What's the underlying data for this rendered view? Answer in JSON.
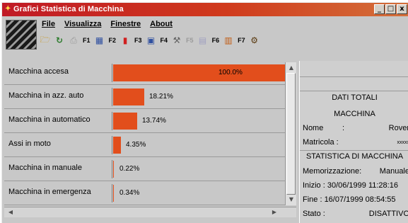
{
  "window": {
    "title": "Grafici Statistica di Macchina",
    "buttons": [
      "_",
      "□",
      "x"
    ]
  },
  "menu": {
    "items": [
      {
        "label": "File"
      },
      {
        "label": "Visualizza"
      },
      {
        "label": "Finestre"
      },
      {
        "label": "About"
      }
    ]
  },
  "toolbar": {
    "groups": [
      {
        "icons": [
          "folder-icon",
          "refresh-icon"
        ],
        "key": ""
      },
      {
        "icons": [
          "print-icon"
        ],
        "key": "F1"
      },
      {
        "icons": [
          "chart-icon"
        ],
        "key": "F2"
      },
      {
        "icons": [
          "alert-icon"
        ],
        "key": "F3"
      },
      {
        "icons": [
          "monitor-icon"
        ],
        "key": "F4"
      },
      {
        "icons": [
          "tools-icon"
        ],
        "key": "F5"
      },
      {
        "icons": [
          "calendar-icon"
        ],
        "key": "F6"
      },
      {
        "icons": [
          "bar-chart-icon"
        ],
        "key": "F7"
      },
      {
        "icons": [
          "exit-icon"
        ],
        "key": ""
      }
    ],
    "disabled_keys": [
      "F5"
    ]
  },
  "stats": {
    "bar_color": "#e24e1c",
    "rows": [
      {
        "label": "Macchina accesa",
        "value": 100.0,
        "text": "100.0%"
      },
      {
        "label": "Macchina in azz. auto",
        "value": 18.21,
        "text": "18.21%"
      },
      {
        "label": "Macchina in automatico",
        "value": 13.74,
        "text": "13.74%"
      },
      {
        "label": "Assi in moto",
        "value": 4.35,
        "text": "4.35%"
      },
      {
        "label": "Macchina in manuale",
        "value": 0.22,
        "text": "0.22%"
      },
      {
        "label": "Macchina in emergenza",
        "value": 0.34,
        "text": "0.34%"
      }
    ]
  },
  "info": {
    "dati_totali": "DATI TOTALI",
    "macchina": "MACCHINA",
    "nome_label": "Nome",
    "nome_sep": ":",
    "nome_value": "Rover",
    "matricola_label": "Matricola :",
    "matricola_value": "xxxxx",
    "statistica": "STATISTICA DI MACCHINA",
    "memo_label": "Memorizzazione:",
    "memo_value": "Manuale",
    "inizio": "Inizio : 30/06/1999 11:28:16",
    "fine": "Fine  : 16/07/1999 08:54:55",
    "stato_label": "Stato :",
    "stato_value": "DISATTIVO"
  }
}
